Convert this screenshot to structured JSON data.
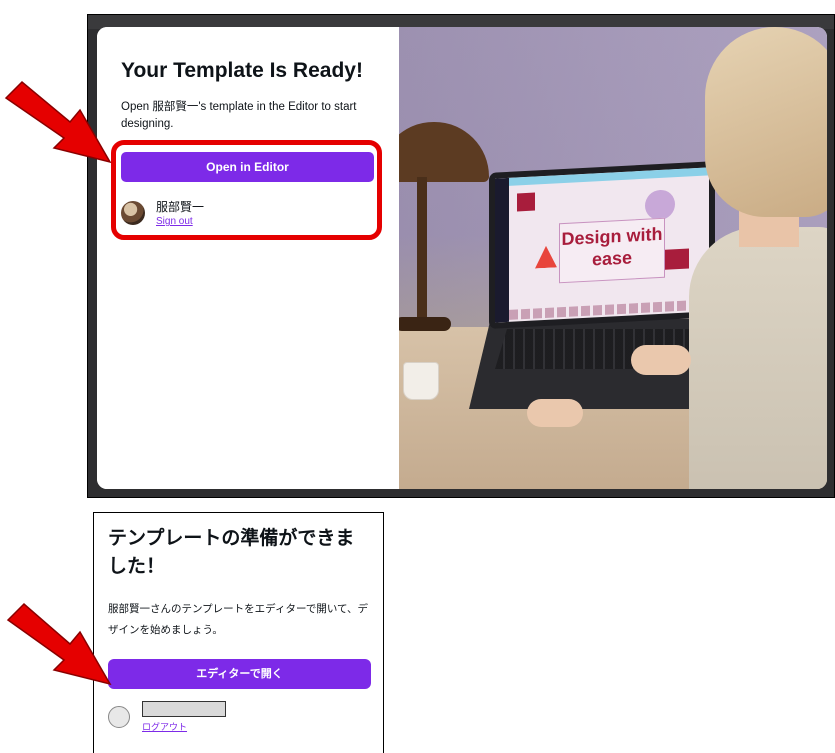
{
  "top_dialog": {
    "title": "Your Template Is Ready!",
    "description": "Open 服部賢一's template in the Editor to start designing.",
    "open_button": "Open in Editor",
    "account_name": "服部賢一",
    "sign_out": "Sign out",
    "preview_design_text": "Design with ease"
  },
  "bottom_dialog": {
    "title": "テンプレートの準備ができました！",
    "description": "服部賢一さんのテンプレートをエディターで開いて、デザインを始めましょう。",
    "open_button": "エディターで開く",
    "logout": "ログアウト"
  },
  "colors": {
    "accent": "#7d2ae8",
    "highlight": "#e50000",
    "arrow": "#e50000"
  },
  "icons": [
    "red-arrow-icon",
    "avatar-icon"
  ]
}
